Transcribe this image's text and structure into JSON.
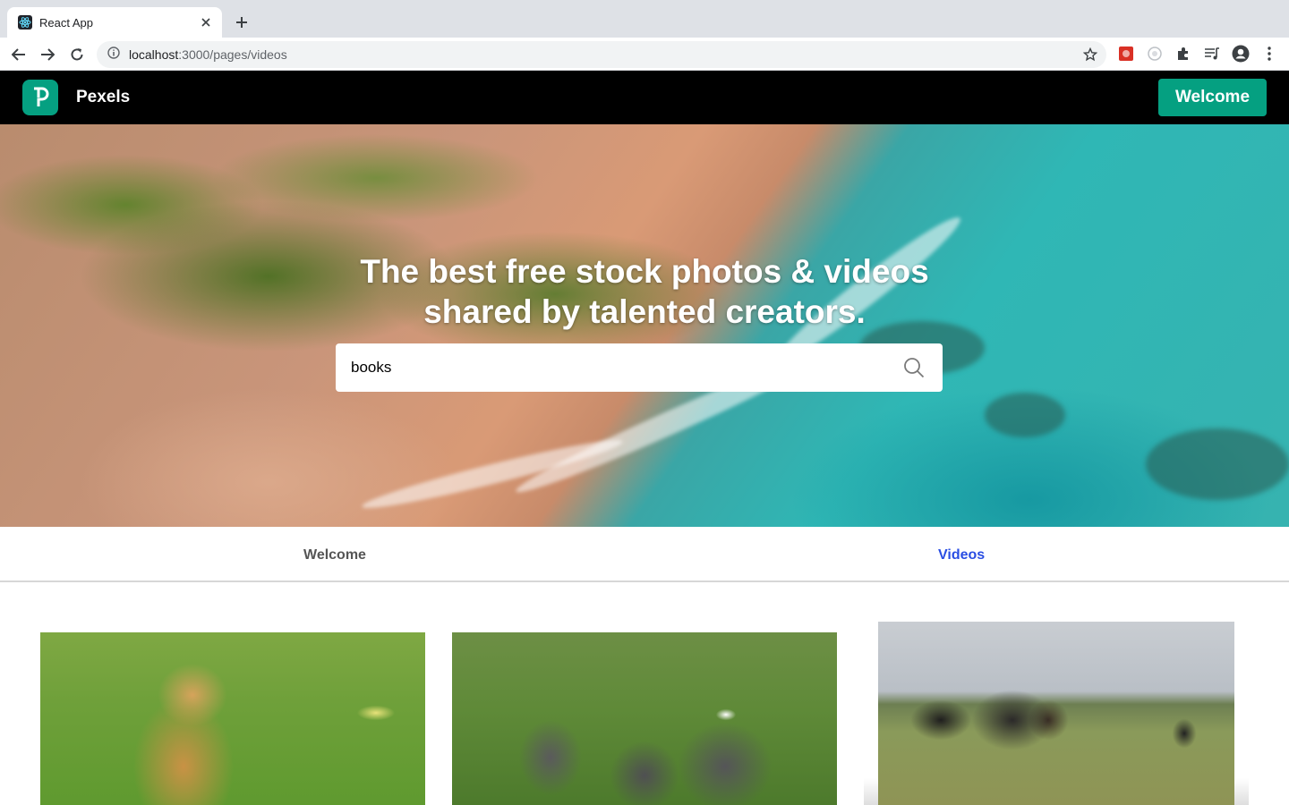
{
  "browser": {
    "tab_title": "React App",
    "url_host": "localhost",
    "url_rest": ":3000/pages/videos"
  },
  "header": {
    "brand": "Pexels",
    "welcome_button": "Welcome",
    "accent_color": "#05a081"
  },
  "hero": {
    "title_line1": "The best free stock photos & videos",
    "title_line2": "shared by talented creators.",
    "search_value": "books"
  },
  "tabs": [
    {
      "label": "Welcome",
      "active": false
    },
    {
      "label": "Videos",
      "active": true,
      "color": "#2a4ee3"
    }
  ],
  "videos": [
    {
      "subject": "monkey"
    },
    {
      "subject": "elephants"
    },
    {
      "subject": "horses"
    }
  ]
}
